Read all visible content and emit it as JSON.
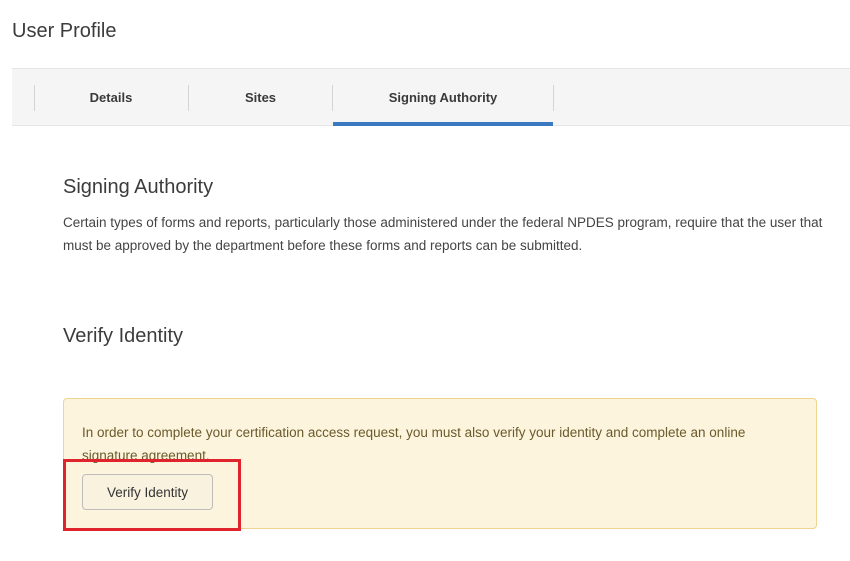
{
  "page": {
    "title": "User Profile"
  },
  "tabs": [
    {
      "label": "Details",
      "active": false
    },
    {
      "label": "Sites",
      "active": false
    },
    {
      "label": "Signing Authority",
      "active": true
    }
  ],
  "signing_authority": {
    "heading": "Signing Authority",
    "description": "Certain types of forms and reports, particularly those administered under the federal NPDES program, require that the user that must be approved by the department before these forms and reports can be submitted."
  },
  "verify_identity": {
    "heading": "Verify Identity",
    "alert_text": "In order to complete your certification access request, you must also verify your identity and complete an online signature agreement.",
    "button_label": "Verify Identity"
  },
  "colors": {
    "active_tab_indicator": "#3a78bf",
    "alert_background": "#fcf4dc",
    "alert_border": "#efd48f",
    "highlight_box": "#e0242e"
  }
}
